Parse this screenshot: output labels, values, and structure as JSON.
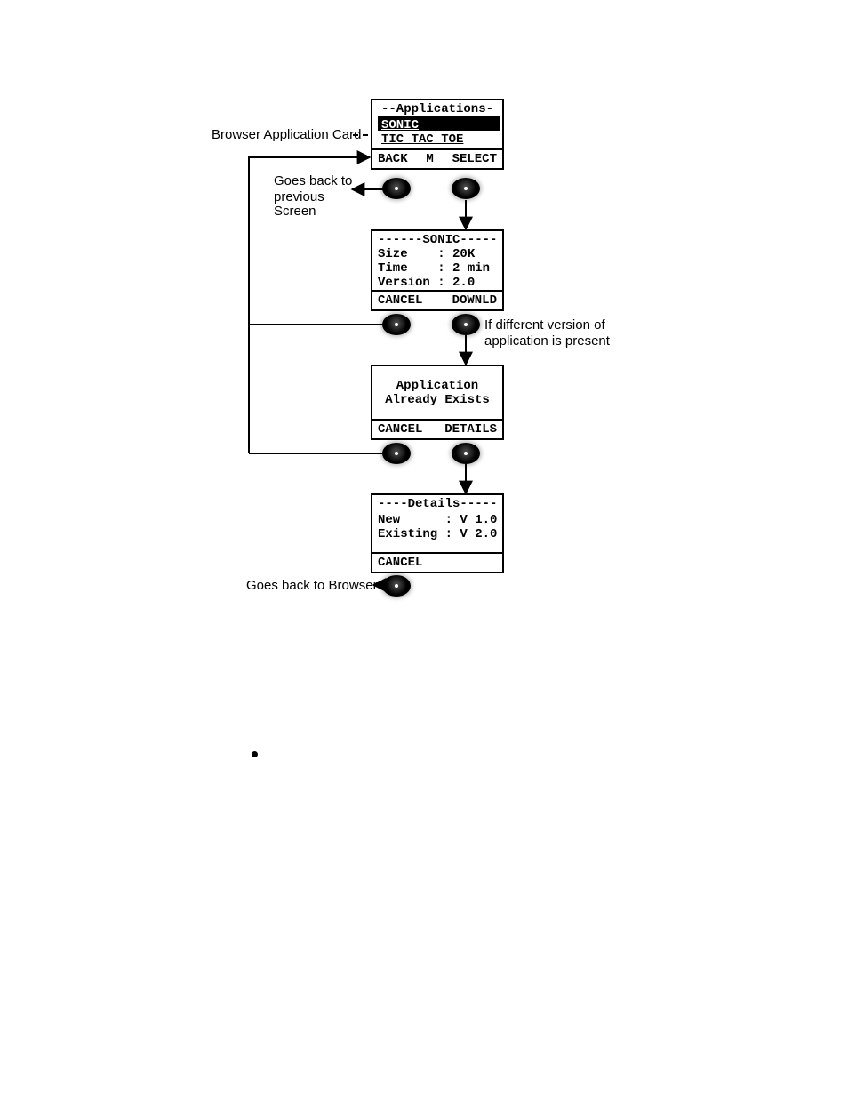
{
  "labels": {
    "browser_card": "Browser Application Card",
    "goes_back_prev_l1": "Goes back to",
    "goes_back_prev_l2": "previous",
    "goes_back_prev_l3": "Screen",
    "diff_version_l1": "If different version of",
    "diff_version_l2": "application is present",
    "goes_back_browser": "Goes back to Browser"
  },
  "screen1": {
    "title": "--Applications--",
    "item_selected": "SONIC",
    "item2": "TIC TAC TOE",
    "sk_left": "BACK",
    "sk_mid": "M",
    "sk_right": "SELECT"
  },
  "screen2": {
    "title": "------SONIC-----",
    "l1": "Size    : 20K",
    "l2": "Time    : 2 min",
    "l3": "Version : 2.0",
    "sk_left": "CANCEL",
    "sk_right": "DOWNLD"
  },
  "screen3": {
    "l1": "Application",
    "l2": "Already Exists",
    "sk_left": "CANCEL",
    "sk_right": "DETAILS"
  },
  "screen4": {
    "title": "----Details-----",
    "l1": "New      : V 1.0",
    "l2": "Existing : V 2.0",
    "sk_left": "CANCEL"
  }
}
